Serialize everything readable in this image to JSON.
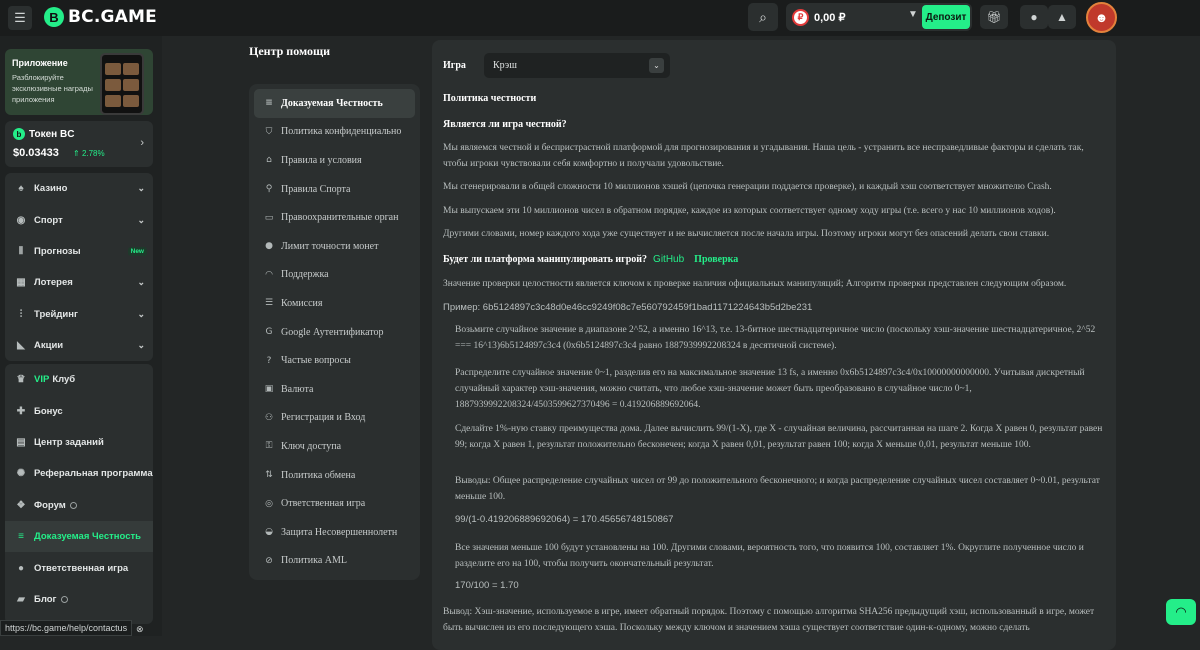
{
  "header": {
    "logo_text": "BC.GAME",
    "balance": "0,00 ₽",
    "currency_symbol": "₽",
    "deposit_label": "Депозит"
  },
  "sidebar": {
    "promo": {
      "title": "Приложение",
      "subtitle": "Разблокируйте эксклюзивные награды приложения"
    },
    "token": {
      "title": "Токен BC",
      "price": "$0.03433",
      "change": "2.78%"
    },
    "games": [
      {
        "label": "Казино",
        "icon": "cards-icon"
      },
      {
        "label": "Спорт",
        "icon": "ball-icon"
      },
      {
        "label": "Прогнозы",
        "icon": "prediction-icon",
        "badge": "New"
      },
      {
        "label": "Лотерея",
        "icon": "ticket-icon"
      },
      {
        "label": "Трейдинг",
        "icon": "trading-icon"
      },
      {
        "label": "Акции",
        "icon": "megaphone-icon"
      }
    ],
    "links": [
      {
        "label": "Клуб",
        "prefix": "VIP",
        "icon": "crown-icon"
      },
      {
        "label": "Бонус",
        "icon": "gift-icon"
      },
      {
        "label": "Центр заданий",
        "icon": "tasks-icon"
      },
      {
        "label": "Реферальная программа",
        "icon": "referral-icon"
      },
      {
        "label": "Форум",
        "icon": "forum-icon",
        "info": true
      },
      {
        "label": "Доказуемая Честность",
        "icon": "fairness-icon",
        "active": true
      },
      {
        "label": "Ответственная игра",
        "icon": "responsible-icon"
      },
      {
        "label": "Блог",
        "icon": "blog-icon",
        "info": true
      }
    ]
  },
  "status_url": "https://bc.game/help/contactus",
  "help": {
    "title": "Центр помощи",
    "items": [
      {
        "label": "Доказуемая Честность",
        "icon": "fairness-icon",
        "active": true
      },
      {
        "label": "Политика конфиденциально",
        "icon": "shield-icon"
      },
      {
        "label": "Правила и условия",
        "icon": "bank-icon"
      },
      {
        "label": "Правила Спорта",
        "icon": "runner-icon"
      },
      {
        "label": "Правоохранительные орган",
        "icon": "id-card-icon"
      },
      {
        "label": "Лимит точности монет",
        "icon": "coin-icon"
      },
      {
        "label": "Поддержка",
        "icon": "headset-icon"
      },
      {
        "label": "Комиссия",
        "icon": "database-icon"
      },
      {
        "label": "Google Аутентификатор",
        "icon": "google-icon"
      },
      {
        "label": "Частые вопросы",
        "icon": "question-icon"
      },
      {
        "label": "Валюта",
        "icon": "currency-icon"
      },
      {
        "label": "Регистрация и Вход",
        "icon": "users-icon"
      },
      {
        "label": "Ключ доступа",
        "icon": "key-icon"
      },
      {
        "label": "Политика обмена",
        "icon": "exchange-icon"
      },
      {
        "label": "Ответственная игра",
        "icon": "responsible-icon"
      },
      {
        "label": "Защита Несовершеннолетн",
        "icon": "stroller-icon"
      },
      {
        "label": "Политика AML",
        "icon": "ban-icon"
      }
    ]
  },
  "content": {
    "game_label": "Игра",
    "game_value": "Крэш",
    "policy_title": "Политика честности",
    "q1": "Является ли игра честной?",
    "p1": "Мы являемся честной и беспристрастной платформой для прогнозирования и угадывания. Наша цель - устранить все несправедливые факторы и сделать так, чтобы игроки чувствовали себя комфортно и получали удовольствие.",
    "p2": "Мы сгенерировали в общей сложности 10 миллионов хэшей (цепочка генерации поддается проверке), и каждый хэш соответствует множителю Crash.",
    "p3": "Мы выпускаем эти 10 миллионов чисел в обратном порядке, каждое из которых соответствует одному ходу игры (т.е. всего у нас 10 миллионов ходов).",
    "p4": "Другими словами, номер каждого хода уже существует и не вычисляется после начала игры. Поэтому игроки могут без опасений делать свои ставки.",
    "q2": "Будет ли платформа манипулировать игрой?",
    "github": "GitHub",
    "verify": "Проверка",
    "p5": "Значение проверки целостности является ключом к проверке наличия официальных манипуляций; Алгоритм проверки представлен следующим образом.",
    "example": "Пример: 6b5124897c3c48d0e46cc9249f08c7e560792459f1bad1171224643b5d2be231",
    "s1": "Возьмите случайное значение в диапазоне 2^52, а именно 16^13, т.е. 13-битное шестнадцатеричное число (поскольку хэш-значение шестнадцатеричное, 2^52 === 16^13)6b5124897c3c4 (0x6b5124897c3c4 равно 1887939992208324 в десятичной системе).",
    "s2": "Распределите случайное значение 0~1, разделив его на максимальное значение 13 fs, а именно 0x6b5124897c3c4/0x10000000000000. Учитывая дискретный случайный характер хэш-значения, можно считать, что любое хэш-значение может быть преобразовано в случайное число 0~1, 1887939992208324/4503599627370496 = 0.419206889692064.",
    "s3": "Сделайте 1%-ную ставку преимущества дома. Далее вычислить 99/(1-X), где X - случайная величина, рассчитанная на шаге 2. Когда X равен 0, результат равен 99; когда X равен 1, результат положительно бесконечен; когда X равен 0,01, результат равен 100; когда X меньше 0,01, результат меньше 100.",
    "s4": "Выводы: Общее распределение случайных чисел от 99 до положительного бесконечного; и когда распределение случайных чисел составляет 0~0.01, результат меньше 100.",
    "s5": "99/(1-0.419206889692064) = 170.45656748150867",
    "s6": "Все значения меньше 100 будут установлены на 100. Другими словами, вероятность того, что появится 100, составляет 1%. Округлите полученное число и разделите его на 100, чтобы получить окончательный результат.",
    "s7": "170/100 = 1.70",
    "p6": "Вывод: Хэш-значение, используемое в игре, имеет обратный порядок. Поэтому с помощью алгоритма SHA256 предыдущий хэш, использованный в игре, может быть вычислен из его последующего хэша. Поскольку между ключом и значением хэша существует соответствие один-к-одному, можно сделать"
  }
}
